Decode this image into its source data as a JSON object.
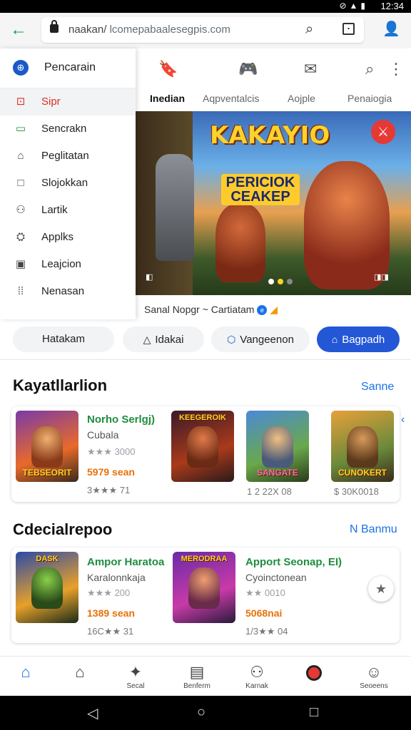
{
  "status": {
    "time": "12:34"
  },
  "url": {
    "prefix": "naakan/",
    "domain": "lcomepabaalesegpis.com"
  },
  "drawer": {
    "header": "Pencarain",
    "items": [
      {
        "label": "Sipr",
        "icon": "store-icon",
        "glyph": "⊡",
        "variant": "red",
        "active": true
      },
      {
        "label": "Sencrakn",
        "icon": "list-icon",
        "glyph": "▭",
        "variant": "green",
        "active": false
      },
      {
        "label": "Peglitatan",
        "icon": "home-icon",
        "glyph": "⌂",
        "variant": "",
        "active": false
      },
      {
        "label": "Slojokkan",
        "icon": "square-icon",
        "glyph": "□",
        "variant": "",
        "active": false
      },
      {
        "label": "Lartik",
        "icon": "person-icon",
        "glyph": "⚇",
        "variant": "",
        "active": false
      },
      {
        "label": "Applks",
        "icon": "apps-icon",
        "glyph": "⛭",
        "variant": "",
        "active": false
      },
      {
        "label": "Leajcion",
        "icon": "library-icon",
        "glyph": "▣",
        "variant": "",
        "active": false
      },
      {
        "label": "Nenasan",
        "icon": "settings-icon",
        "glyph": "⁞⁞",
        "variant": "",
        "active": false
      }
    ]
  },
  "tabs": [
    {
      "label": "Inedian"
    },
    {
      "label": "Aqpventalcis"
    },
    {
      "label": "Aojple"
    },
    {
      "label": "Penaiogia"
    }
  ],
  "banner": {
    "title": "KAKAYIO",
    "subtitle": "PERICIOK CEAKEP",
    "caption": "Sanal Nopgr ~ Cartiatam",
    "caption_badge": "e",
    "caption_mark": "◢",
    "ctrl_left": "◧",
    "ctrl_right": "◨◨",
    "dot_colors": [
      "#ffffff",
      "#ffd22a",
      "#888888"
    ]
  },
  "chips": [
    {
      "label": "Hatakam",
      "icon": ""
    },
    {
      "label": "Idakai",
      "icon": "△"
    },
    {
      "label": "Vangeenon",
      "icon": "⬡"
    },
    {
      "label": "Bagpadh",
      "icon": "⌂"
    }
  ],
  "section1": {
    "title": "Kayatllarlion",
    "link": "Sanne",
    "app": {
      "name": "Norho Serlgj)",
      "sub": "Cubala",
      "rating": "★★★ 3000",
      "price": "5979 sean",
      "foot": "3★★★ 71",
      "thumb_label": "TEBSEORIT"
    },
    "thumbs": [
      {
        "label": "KEEGEROIK",
        "caption": ""
      },
      {
        "label": "SANGATE",
        "caption": "1 2 22X 08"
      },
      {
        "label": "CUNOKERT",
        "caption": "$ 30K0018"
      }
    ]
  },
  "section2": {
    "title": "Cdecialrepoo",
    "link": "N Banmu",
    "apps": [
      {
        "name": "Ampor Haratoa",
        "sub": "Karalonnkaja",
        "rating": "★★★ 200",
        "price": "1389 sean",
        "foot": "16C★★ 31",
        "thumb_label": "DASK"
      },
      {
        "name": "Apport Seonap, EI)",
        "sub": "Cyoinctonean",
        "rating": "★★ 0010",
        "price": "5068nai",
        "foot": "1/3★★ 04",
        "thumb_label": "MERODRAA"
      }
    ]
  },
  "bottomnav": [
    {
      "label": "",
      "icon": "home-filled-icon"
    },
    {
      "label": "",
      "icon": "home-outline-icon"
    },
    {
      "label": "Secal",
      "icon": "puzzle-icon"
    },
    {
      "label": "Benferm",
      "icon": "book-icon"
    },
    {
      "label": "Karnak",
      "icon": "person-icon"
    },
    {
      "label": "",
      "icon": "record-icon"
    },
    {
      "label": "Seoeens",
      "icon": "face-icon"
    }
  ],
  "colors": {
    "accent": "#1a73e8",
    "primary_chip": "#2457d6",
    "green": "#1e8e3e",
    "price": "#e8710a"
  }
}
